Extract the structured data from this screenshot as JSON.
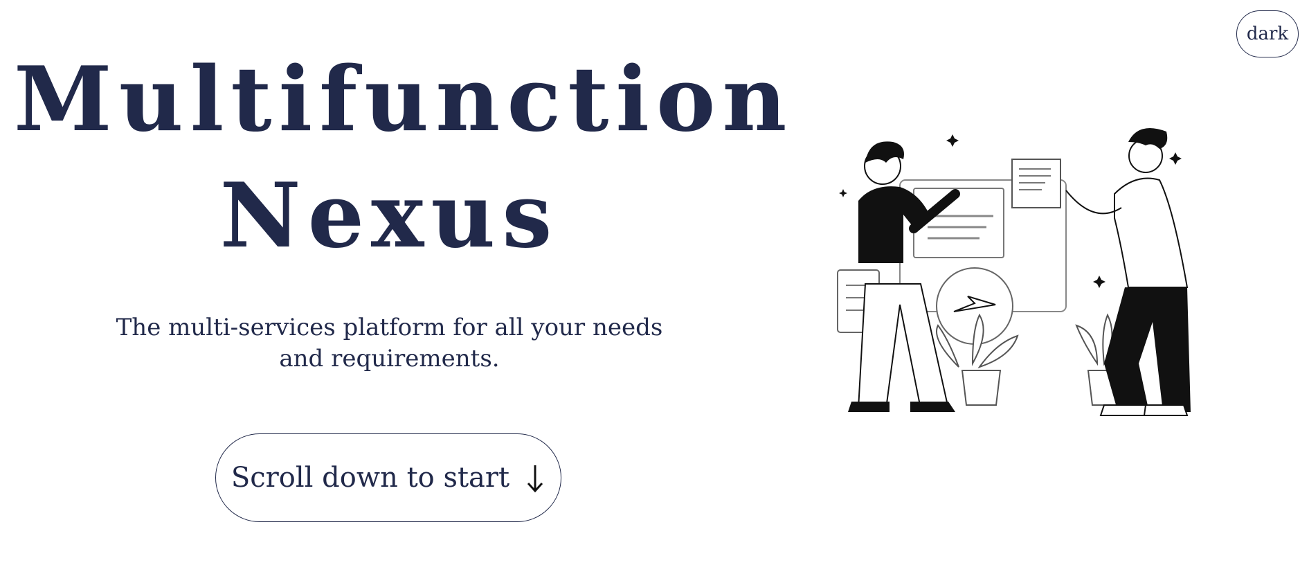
{
  "theme_toggle": {
    "label": "dark"
  },
  "hero": {
    "title_line1": "Multifunction",
    "title_line2": "Nexus",
    "subtitle": "The multi-services platform for all your needs and requirements.",
    "cta_label": "Scroll down to start",
    "cta_icon": "arrow-down-icon"
  },
  "colors": {
    "primary": "#21294a",
    "background": "#ffffff",
    "illustration_ink": "#111111"
  }
}
